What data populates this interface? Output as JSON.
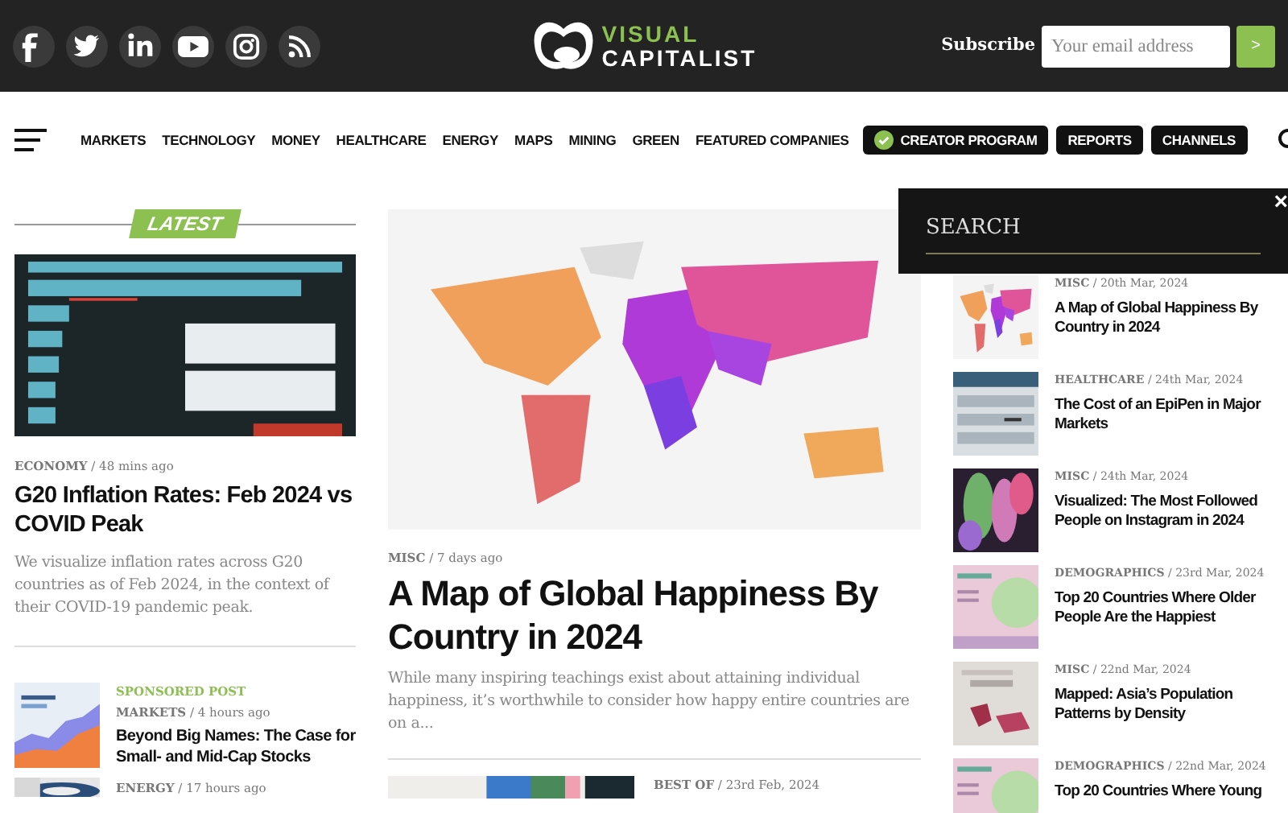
{
  "header": {
    "social_icons": [
      {
        "kind": "facebook"
      },
      {
        "kind": "twitter"
      },
      {
        "kind": "linkedin"
      },
      {
        "kind": "youtube"
      },
      {
        "kind": "instagram"
      },
      {
        "kind": "rss"
      }
    ],
    "logo": {
      "line1": "VISUAL",
      "line2": "CAPITALIST"
    },
    "subscribe": {
      "label": "Subscribe",
      "placeholder": "Your email address",
      "button": ">"
    }
  },
  "nav": {
    "items": [
      {
        "label": "MARKETS",
        "kind": "link"
      },
      {
        "label": "TECHNOLOGY",
        "kind": "link"
      },
      {
        "label": "MONEY",
        "kind": "link"
      },
      {
        "label": "HEALTHCARE",
        "kind": "link"
      },
      {
        "label": "ENERGY",
        "kind": "link"
      },
      {
        "label": "MAPS",
        "kind": "link"
      },
      {
        "label": "MINING",
        "kind": "link"
      },
      {
        "label": "GREEN",
        "kind": "link"
      },
      {
        "label": "FEATURED COMPANIES",
        "kind": "link"
      },
      {
        "label": "CREATOR PROGRAM",
        "kind": "check_pill"
      },
      {
        "label": "REPORTS",
        "kind": "pill"
      },
      {
        "label": "CHANNELS",
        "kind": "pill"
      }
    ]
  },
  "latest": {
    "label": "LATEST",
    "lead": {
      "meta": "**ECONOMY** / 48 mins ago",
      "title": "G20 Inflation Rates: Feb 2024 vs COVID Peak",
      "summary": "We visualize inflation rates across G20 countries as of Feb 2024, in the context of their COVID-19 pandemic peak."
    },
    "items": [
      {
        "sponsored": "SPONSORED POST",
        "meta": "**MARKETS** / 4 hours ago",
        "title": "Beyond Big Names: The Case for Small- and Mid-Cap Stocks"
      },
      {
        "meta": "**ENERGY** / 17 hours ago"
      }
    ]
  },
  "featured": {
    "meta": "**MISC** / 7 days ago",
    "title": "A Map of Global Happiness By Country in 2024",
    "summary": "While many inspiring teachings exist about attaining individual happiness, it’s worthwhile to consider how happy entire countries are on a..."
  },
  "featured_next": {
    "meta": "**BEST OF** / 23rd Feb, 2024"
  },
  "search_panel": {
    "label": "SEARCH",
    "close": "×"
  },
  "popular": [
    {
      "meta": "**MISC** / 20th Mar, 2024",
      "title": "A Map of Global Happiness By Country in 2024"
    },
    {
      "meta": "**HEALTHCARE** / 24th Mar, 2024",
      "title": "The Cost of an EpiPen in Major Markets"
    },
    {
      "meta": "**MISC** / 24th Mar, 2024",
      "title": "Visualized: The Most Followed People on Instagram in 2024"
    },
    {
      "meta": "**DEMOGRAPHICS** / 23rd Mar, 2024",
      "title": "Top 20 Countries Where Older People Are the Happiest"
    },
    {
      "meta": "**MISC** / 22nd Mar, 2024",
      "title": "Mapped: Asia’s Population Patterns by Density"
    },
    {
      "meta": "**DEMOGRAPHICS** / 22nd Mar, 2024",
      "title": "Top 20 Countries Where Young"
    }
  ]
}
